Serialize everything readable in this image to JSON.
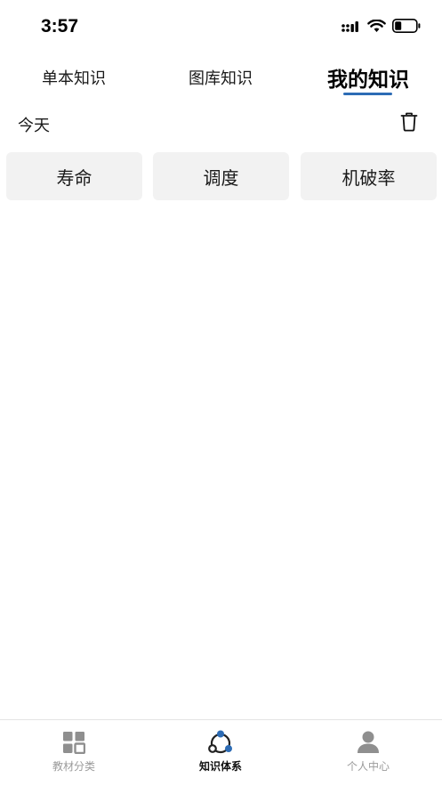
{
  "status_bar": {
    "time": "3:57"
  },
  "top_tabs": [
    {
      "label": "单本知识",
      "active": false
    },
    {
      "label": "图库知识",
      "active": false
    },
    {
      "label": "我的知识",
      "active": true
    }
  ],
  "section": {
    "title": "今天"
  },
  "knowledge_items": [
    {
      "label": "寿命"
    },
    {
      "label": "调度"
    },
    {
      "label": "机破率"
    }
  ],
  "bottom_nav": [
    {
      "label": "教材分类",
      "icon": "grid-icon",
      "active": false
    },
    {
      "label": "知识体系",
      "icon": "network-icon",
      "active": true
    },
    {
      "label": "个人中心",
      "icon": "person-icon",
      "active": false
    }
  ],
  "colors": {
    "accent": "#2d6cb5",
    "chip_bg": "#f2f2f2",
    "inactive_label": "#9a9a9a"
  }
}
